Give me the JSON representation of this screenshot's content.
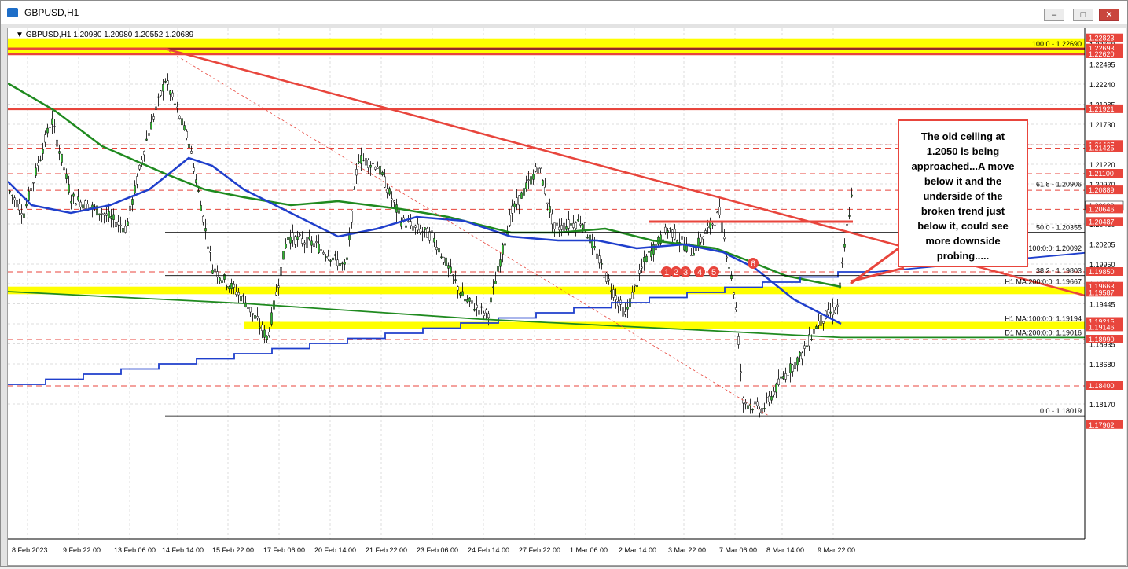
{
  "window": {
    "title": "GBPUSD,H1",
    "buttons": [
      "minimize",
      "restore",
      "close"
    ]
  },
  "chart_info": "GBPUSD,H1  1.20980 1.20980 1.20552 1.20689",
  "price_axis": {
    "ticks": [
      "1.22750",
      "1.22495",
      "1.22240",
      "1.21985",
      "1.21730",
      "1.21475",
      "1.21220",
      "1.20970",
      "1.20715",
      "1.20460",
      "1.20205",
      "1.19950",
      "1.19700",
      "1.19445",
      "1.19190",
      "1.18935",
      "1.18680",
      "1.18425",
      "1.18170"
    ],
    "price_labels": [
      {
        "value": "1.22823",
        "bg": "#e8453c"
      },
      {
        "value": "1.22693",
        "bg": "#e8453c"
      },
      {
        "value": "1.22620",
        "bg": "#e8453c"
      },
      {
        "value": "1.21921",
        "bg": "#e8453c"
      },
      {
        "value": "1.21467",
        "bg": "#e8453c"
      },
      {
        "value": "1.21425",
        "bg": "#e8453c"
      },
      {
        "value": "1.21100",
        "bg": "#e8453c"
      },
      {
        "value": "1.20889",
        "bg": "#e8453c"
      },
      {
        "value": "1.20690",
        "bg": "#ffffff"
      },
      {
        "value": "1.20646",
        "bg": "#e8453c"
      },
      {
        "value": "1.20487",
        "bg": "#e8453c"
      },
      {
        "value": "1.19850",
        "bg": "#e8453c"
      },
      {
        "value": "1.19663",
        "bg": "#e8453c"
      },
      {
        "value": "1.19587",
        "bg": "#e8453c"
      },
      {
        "value": "1.19215",
        "bg": "#e8453c"
      },
      {
        "value": "1.19146",
        "bg": "#e8453c"
      },
      {
        "value": "1.18990",
        "bg": "#e8453c"
      },
      {
        "value": "1.18400",
        "bg": "#e8453c"
      },
      {
        "value": "1.17902",
        "bg": "#e8453c"
      }
    ]
  },
  "time_axis": [
    "8 Feb 2023",
    "9 Feb 22:00",
    "13 Feb 06:00",
    "14 Feb 14:00",
    "15 Feb 22:00",
    "17 Feb 06:00",
    "20 Feb 14:00",
    "21 Feb 22:00",
    "23 Feb 06:00",
    "24 Feb 14:00",
    "27 Feb 22:00",
    "1 Mar 06:00",
    "2 Mar 14:00",
    "3 Mar 22:00",
    "7 Mar 06:00",
    "8 Mar 14:00",
    "9 Mar 22:00"
  ],
  "line_labels": [
    "100.0 - 1.22690",
    "61.8 - 1.20906",
    "50.0 - 1.20355",
    "D1 MA:100:0:0: 1.20092",
    "38.2 - 1.19803",
    "H1 MA:200:0:0: 1.19667",
    "H1 MA:100:0:0: 1.19194",
    "D1 MA:200:0:0: 1.19016",
    "0.0 - 1.18019"
  ],
  "markers": [
    "1",
    "2",
    "3",
    "4",
    "5",
    "6"
  ],
  "callout_text": "The old ceiling at 1.2050 is being approached...A move below it and the underside of the broken trend just below it, could see more downside probing.....",
  "colors": {
    "support_zone": "#ffff00",
    "resistance": "#e8453c",
    "ma_green": "#1f8a1f",
    "ma_blue": "#1f3fcc",
    "candle": "#2db82d"
  }
}
